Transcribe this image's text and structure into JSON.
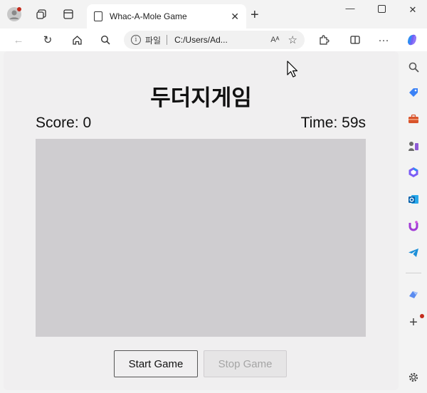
{
  "browser": {
    "tab_title": "Whac-A-Mole Game",
    "address_label": "파일",
    "address_url": "C:/Users/Ad...",
    "read_aloud": "Aᴬ"
  },
  "game": {
    "title": "두더지게임",
    "score": "Score: 0",
    "time": "Time: 59s",
    "start_button": "Start Game",
    "stop_button": "Stop Game"
  }
}
